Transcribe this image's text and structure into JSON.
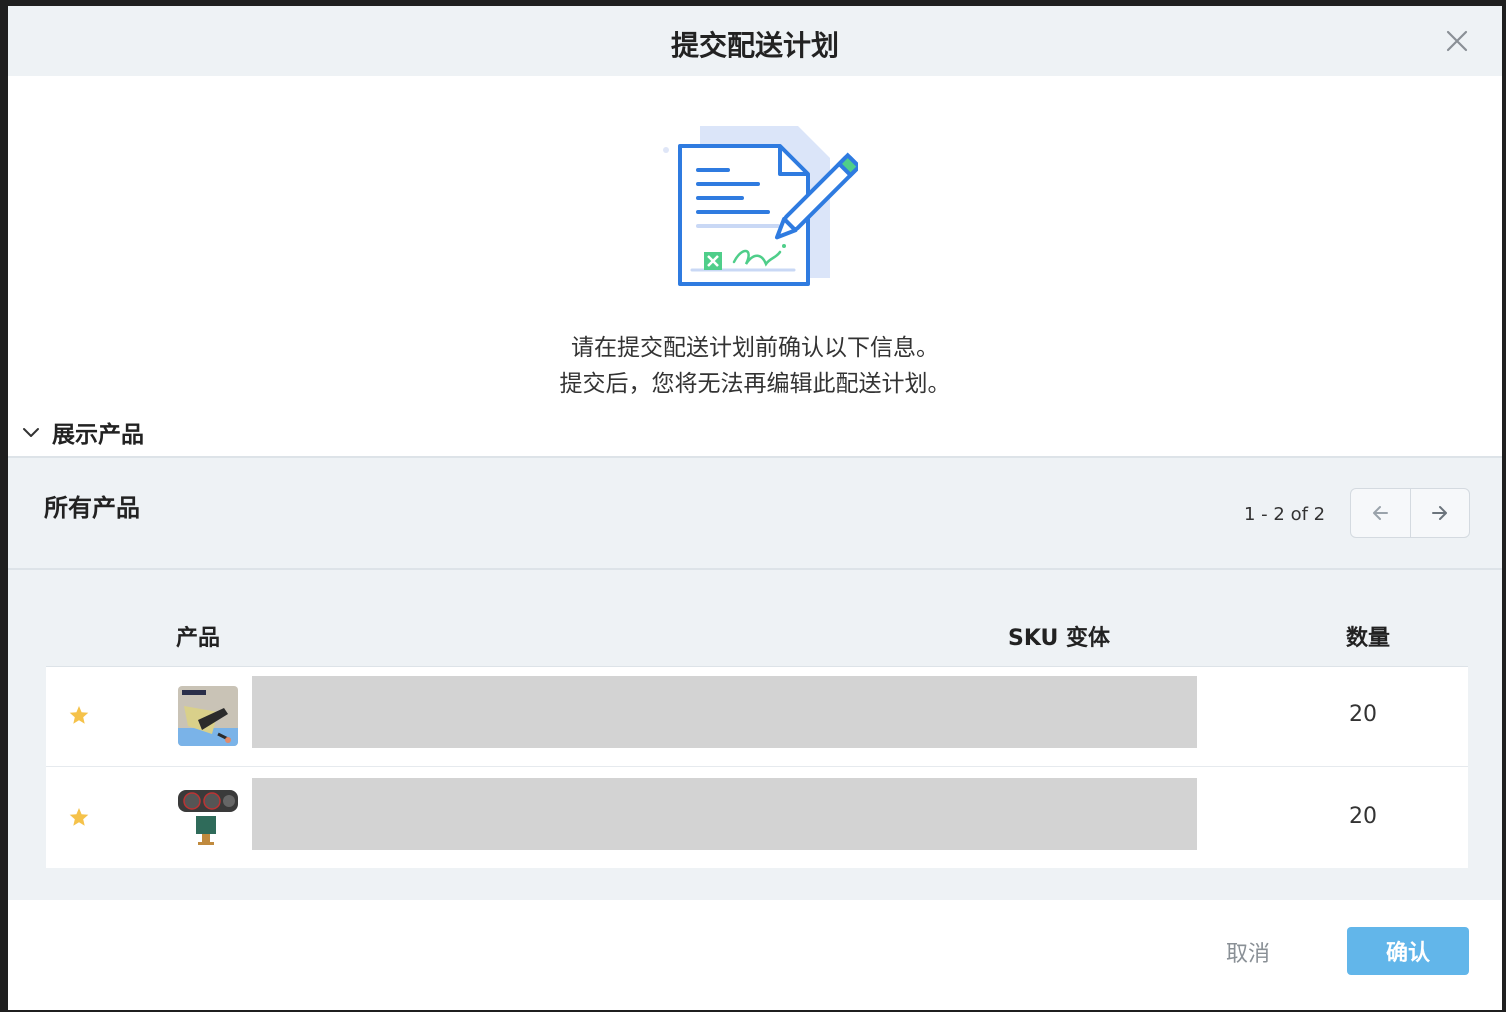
{
  "dialog": {
    "title": "提交配送计划",
    "message_line1": "请在提交配送计划前确认以下信息。",
    "message_line2": "提交后，您将无法再编辑此配送计划。"
  },
  "toggle": {
    "label": "展示产品",
    "icon": "chevron-down-icon"
  },
  "products_panel": {
    "title": "所有产品",
    "range": "1 - 2 of 2"
  },
  "table": {
    "columns": [
      "产品",
      "SKU 变体",
      "数量"
    ],
    "rows": [
      {
        "quantity": "20",
        "thumbnail": "product-thumbnail-car-seat-mount"
      },
      {
        "quantity": "20",
        "thumbnail": "product-thumbnail-dashboard-gauges"
      }
    ]
  },
  "footer": {
    "cancel_label": "取消",
    "confirm_label": "确认"
  },
  "colors": {
    "header_bg": "#eef2f5",
    "accent": "#62b6ea",
    "illustration_blue": "#2f7be0",
    "star": "#f5c24a"
  }
}
